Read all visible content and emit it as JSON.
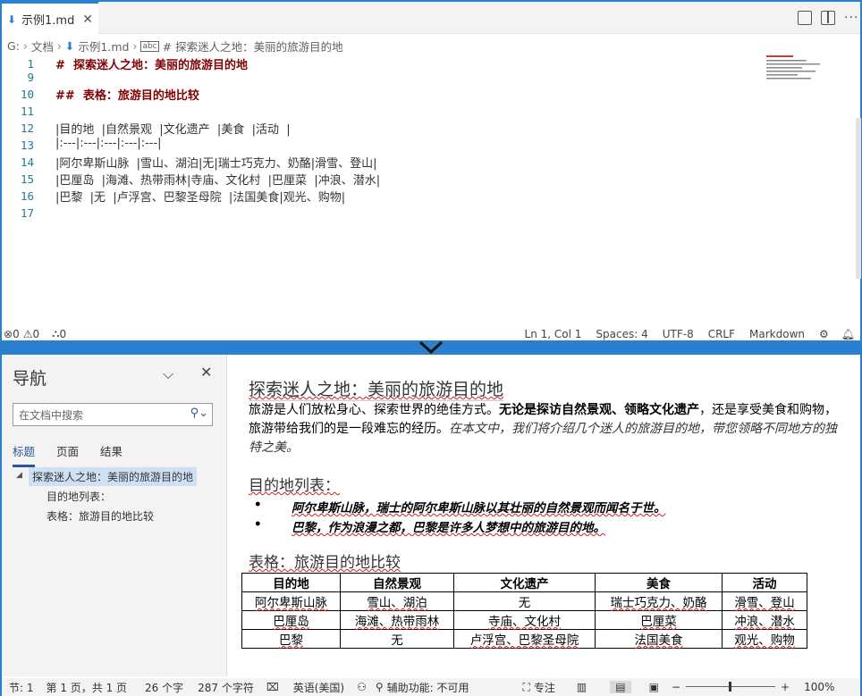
{
  "tab": {
    "filename": "示例1.md",
    "close": "✕"
  },
  "breadcrumb": {
    "drive": "G:",
    "folder": "文档",
    "file": "示例1.md",
    "symbol": "# 探索迷人之地：美丽的旅游目的地"
  },
  "editor": {
    "lines": [
      {
        "num": "1",
        "text": "#  探索迷人之地：美丽的旅游目的地",
        "heading": true
      },
      {
        "num": "9",
        "text": "",
        "heading": false
      },
      {
        "num": "10",
        "text": "##  表格：旅游目的地比较",
        "heading": true
      },
      {
        "num": "11",
        "text": "",
        "heading": false
      },
      {
        "num": "12",
        "text": "|目的地  |自然景观  |文化遗产  |美食  |活动  |",
        "heading": false
      },
      {
        "num": "13",
        "text": "|:---|:---|:---|:---|:---|",
        "heading": false
      },
      {
        "num": "14",
        "text": "|阿尔卑斯山脉  |雪山、湖泊|无|瑞士巧克力、奶酪|滑雪、登山|",
        "heading": false
      },
      {
        "num": "15",
        "text": "|巴厘岛  |海滩、热带雨林|寺庙、文化村  |巴厘菜  |冲浪、潜水|",
        "heading": false
      },
      {
        "num": "16",
        "text": "|巴黎  |无  |卢浮宫、巴黎圣母院  |法国美食|观光、购物|",
        "heading": false
      },
      {
        "num": "17",
        "text": "",
        "heading": false
      }
    ]
  },
  "status": {
    "errors": "0",
    "warnings": "0",
    "ports": "0",
    "position": "Ln 1, Col 1",
    "spaces": "Spaces: 4",
    "encoding": "UTF-8",
    "eol": "CRLF",
    "language": "Markdown"
  },
  "nav": {
    "title": "导航",
    "search_placeholder": "在文档中搜索",
    "tabs": [
      "标题",
      "页面",
      "结果"
    ],
    "tree": [
      "探索迷人之地：美丽的旅游目的地",
      "目的地列表：",
      "表格：旅游目的地比较"
    ]
  },
  "doc": {
    "h1": "探索迷人之地：美丽的旅游目的地",
    "p1_a": "旅游是人们放松身心、探索世界的绝佳方式。",
    "p1_b": "无论是探访自然景观、领略文化遗产",
    "p1_c": "，还是享受美食和购物，旅游带给我们的是一段难忘的经历。",
    "p1_d": "在本文中，我们将介绍几个迷人的旅游目的地，带您领略不同地方的独特之美。",
    "h2_list": "目的地列表：",
    "list": [
      "阿尔卑斯山脉，瑞士的阿尔卑斯山脉以其壮丽的自然景观而闻名于世。",
      "巴黎，作为浪漫之都，巴黎是许多人梦想中的旅游目的地。"
    ],
    "h2_table": "表格：旅游目的地比较",
    "table": {
      "headers": [
        "目的地",
        "自然景观",
        "文化遗产",
        "美食",
        "活动"
      ],
      "rows": [
        [
          "阿尔卑斯山脉",
          "雪山、湖泊",
          "无",
          "瑞士巧克力、奶酪",
          "滑雪、登山"
        ],
        [
          "巴厘岛",
          "海滩、热带雨林",
          "寺庙、文化村",
          "巴厘菜",
          "冲浪、潜水"
        ],
        [
          "巴黎",
          "无",
          "卢浮宫、巴黎圣母院",
          "法国美食",
          "观光、购物"
        ]
      ]
    }
  },
  "wstatus": {
    "section": "节: 1",
    "page": "第 1 页，共 1 页",
    "words": "26 个字",
    "chars": "287 个字符",
    "lang": "英语(美国)",
    "access": "辅助功能: 不可用",
    "focus": "专注",
    "zoom_minus": "−",
    "zoom_plus": "+",
    "zoom": "100%"
  }
}
